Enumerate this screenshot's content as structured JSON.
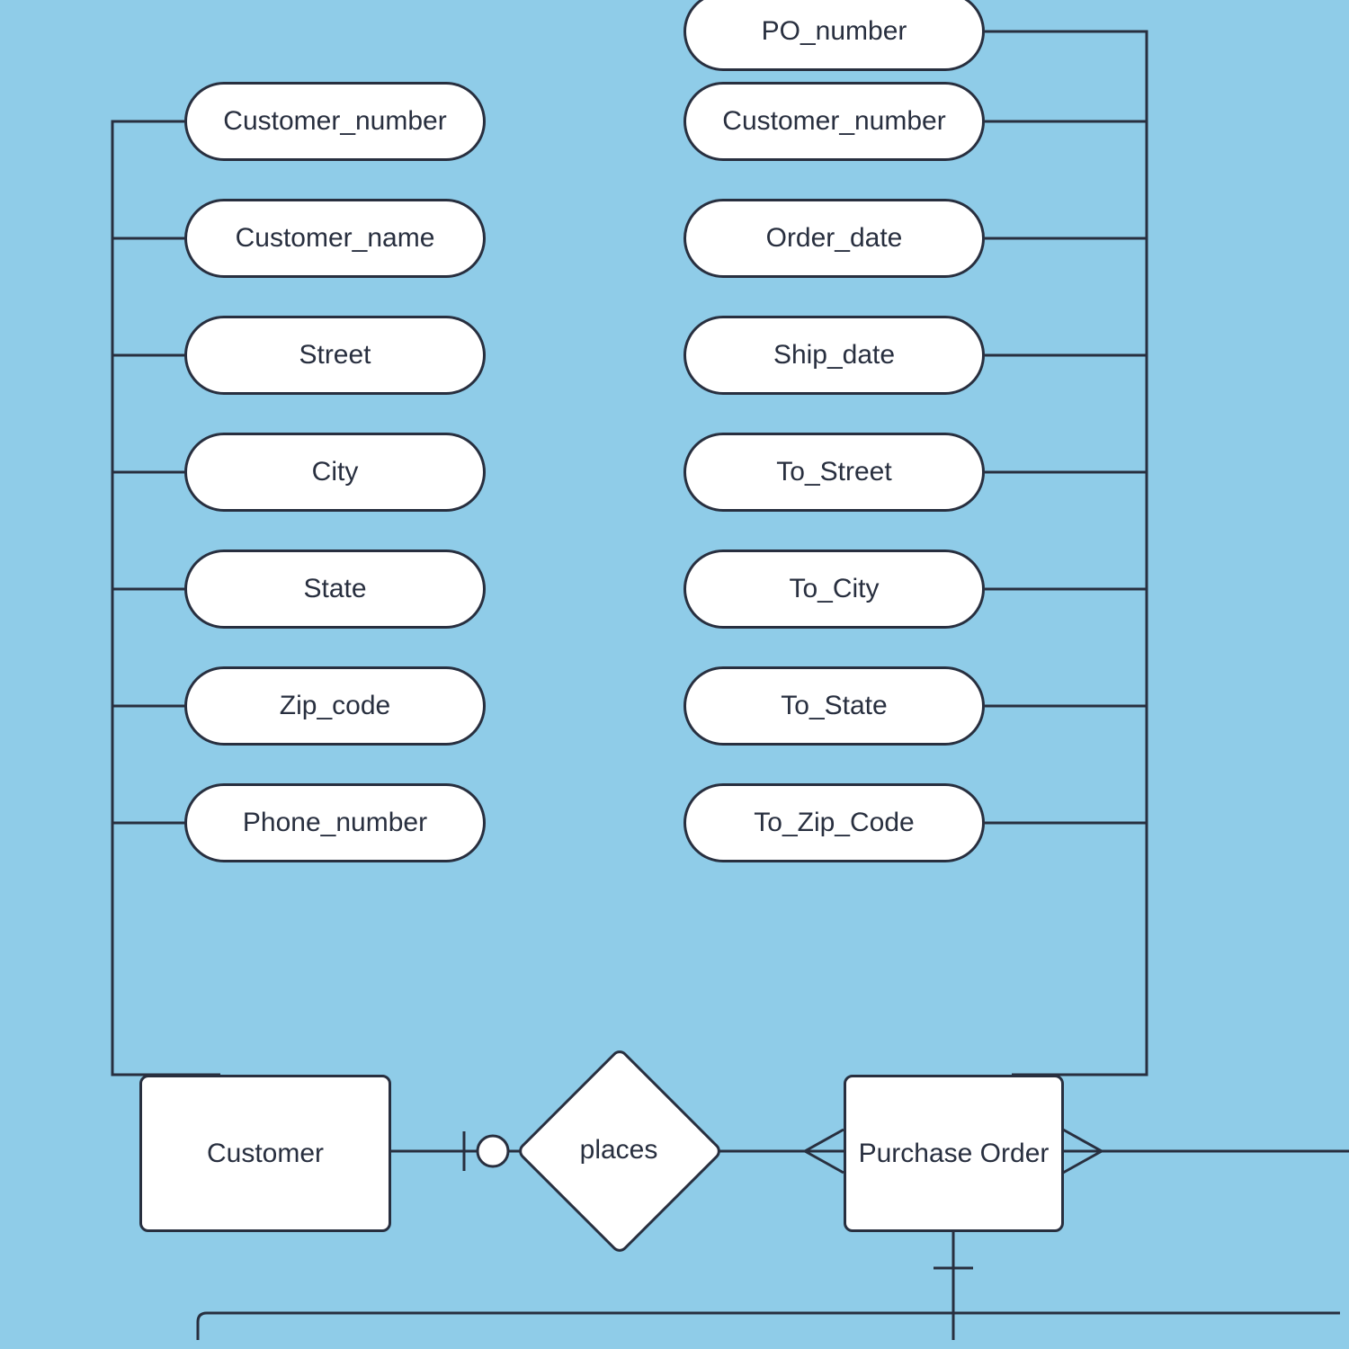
{
  "entities": {
    "customer": {
      "label": "Customer",
      "attributes": [
        "Customer_number",
        "Customer_name",
        "Street",
        "City",
        "State",
        "Zip_code",
        "Phone_number"
      ]
    },
    "purchase_order": {
      "label": "Purchase Order",
      "attributes": [
        "PO_number",
        "Customer_number",
        "Order_date",
        "Ship_date",
        "To_Street",
        "To_City",
        "To_State",
        "To_Zip_Code"
      ]
    }
  },
  "relationships": {
    "places": {
      "label": "places"
    }
  },
  "colors": {
    "bg": "#8fcce8",
    "fill": "#ffffff",
    "stroke": "#282f3f"
  }
}
